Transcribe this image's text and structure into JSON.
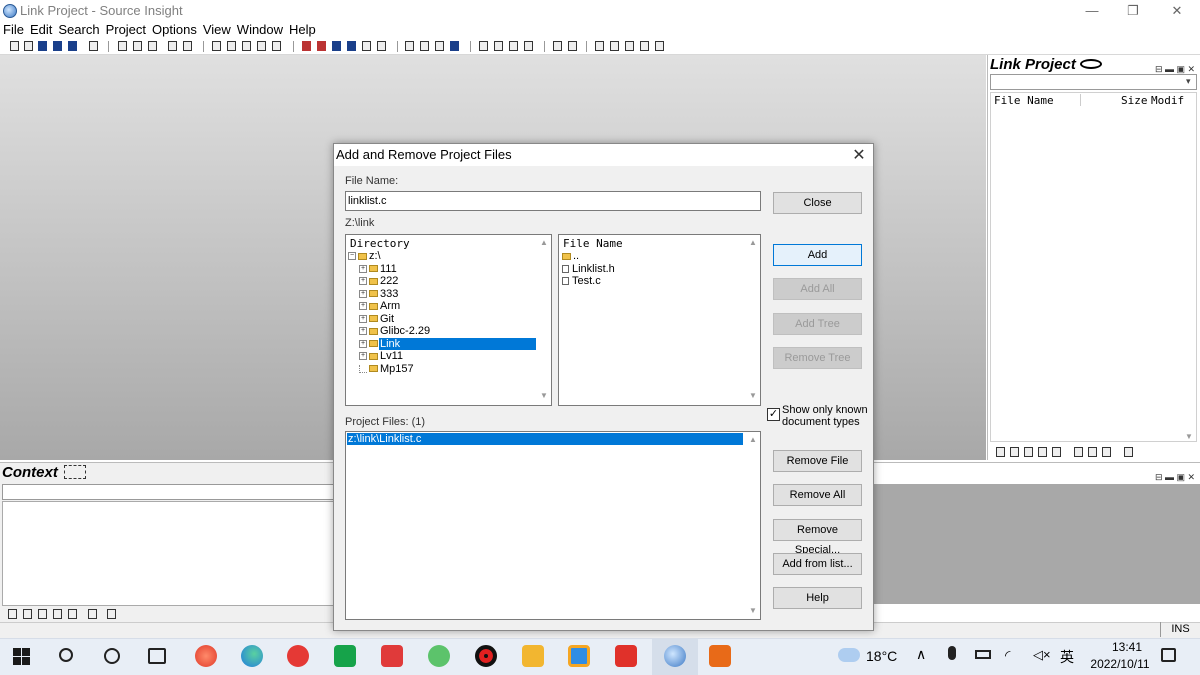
{
  "window": {
    "title": "Link Project - Source Insight",
    "controls": [
      "—",
      "❐",
      "✕"
    ]
  },
  "menu": [
    "File",
    "Edit",
    "Search",
    "Project",
    "Options",
    "View",
    "Window",
    "Help"
  ],
  "project_panel": {
    "title": "Link Project",
    "columns": {
      "name": "File Name",
      "size": "Size",
      "modified": "Modif"
    },
    "panel_controls": "⊟ ▬ ▣ ✕"
  },
  "context_panel": {
    "title": "Context",
    "panel_controls": "⊟ ▬ ▣ ✕"
  },
  "relation_panel": {
    "panel_controls": "⊟ ▬ ▣ ✕"
  },
  "status": {
    "mode": "INS"
  },
  "dialog": {
    "title": "Add and Remove Project Files",
    "file_name_label": "File Name:",
    "file_name_value": "linklist.c",
    "current_path": "Z:\\link",
    "directory_header": "Directory",
    "directory_tree": [
      {
        "label": "z:\\",
        "level": 0,
        "expanded": true
      },
      {
        "label": "111",
        "level": 1
      },
      {
        "label": "222",
        "level": 1
      },
      {
        "label": "333",
        "level": 1
      },
      {
        "label": "Arm",
        "level": 1
      },
      {
        "label": "Git",
        "level": 1
      },
      {
        "label": "Glibc-2.29",
        "level": 1
      },
      {
        "label": "Link",
        "level": 1,
        "selected": true
      },
      {
        "label": "Lv11",
        "level": 1
      },
      {
        "label": "Mp157",
        "level": 1,
        "last": true
      }
    ],
    "files_header": "File Name",
    "files": [
      {
        "label": "..",
        "type": "folder"
      },
      {
        "label": "Linklist.h",
        "type": "file"
      },
      {
        "label": "Test.c",
        "type": "file"
      }
    ],
    "project_files_label": "Project Files: (1)",
    "project_files": [
      "z:\\link\\Linklist.c"
    ],
    "show_only_known": {
      "label": "Show only known document types",
      "checked": true
    },
    "buttons": {
      "close": "Close",
      "add": "Add",
      "add_all": "Add All",
      "add_tree": "Add Tree",
      "remove_tree": "Remove Tree",
      "remove_file": "Remove File",
      "remove_all": "Remove All",
      "remove_special": "Remove Special...",
      "add_from_list": "Add from list...",
      "help": "Help"
    }
  },
  "taskbar": {
    "temperature": "18°C",
    "input_language": "英",
    "time": "13:41",
    "date": "2022/10/11"
  }
}
